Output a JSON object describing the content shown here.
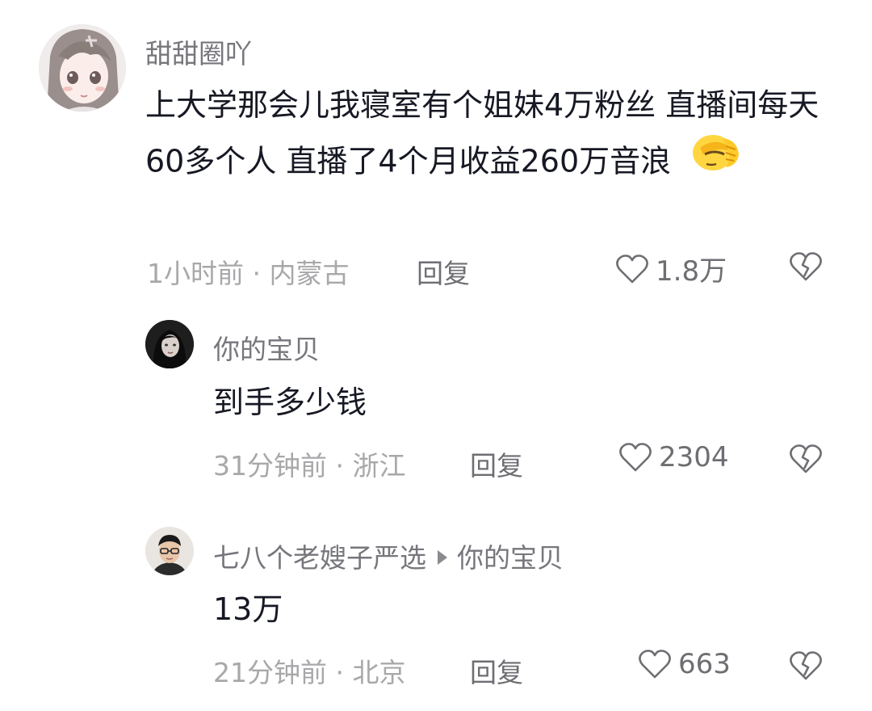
{
  "comments": [
    {
      "username": "甜甜圈吖",
      "text": "上大学那会儿我寝室有个姐妹4万粉丝 直播间每天60多个人 直播了4个月收益260万音浪",
      "emoji_icon": "facepalm-emoji",
      "time_location": "1小时前 · 内蒙古",
      "reply_label": "回复",
      "likes": "1.8万"
    },
    {
      "username": "你的宝贝",
      "text": "到手多少钱",
      "time_location": "31分钟前 · 浙江",
      "reply_label": "回复",
      "likes": "2304"
    },
    {
      "username": "七八个老嫂子严选",
      "reply_to": "你的宝贝",
      "text": "13万",
      "time_location": "21分钟前 · 北京",
      "reply_label": "回复",
      "likes": "663"
    }
  ],
  "colors": {
    "username": "#76767c",
    "text": "#161823",
    "meta": "#a8a8ab",
    "icon": "#6e6e73"
  }
}
